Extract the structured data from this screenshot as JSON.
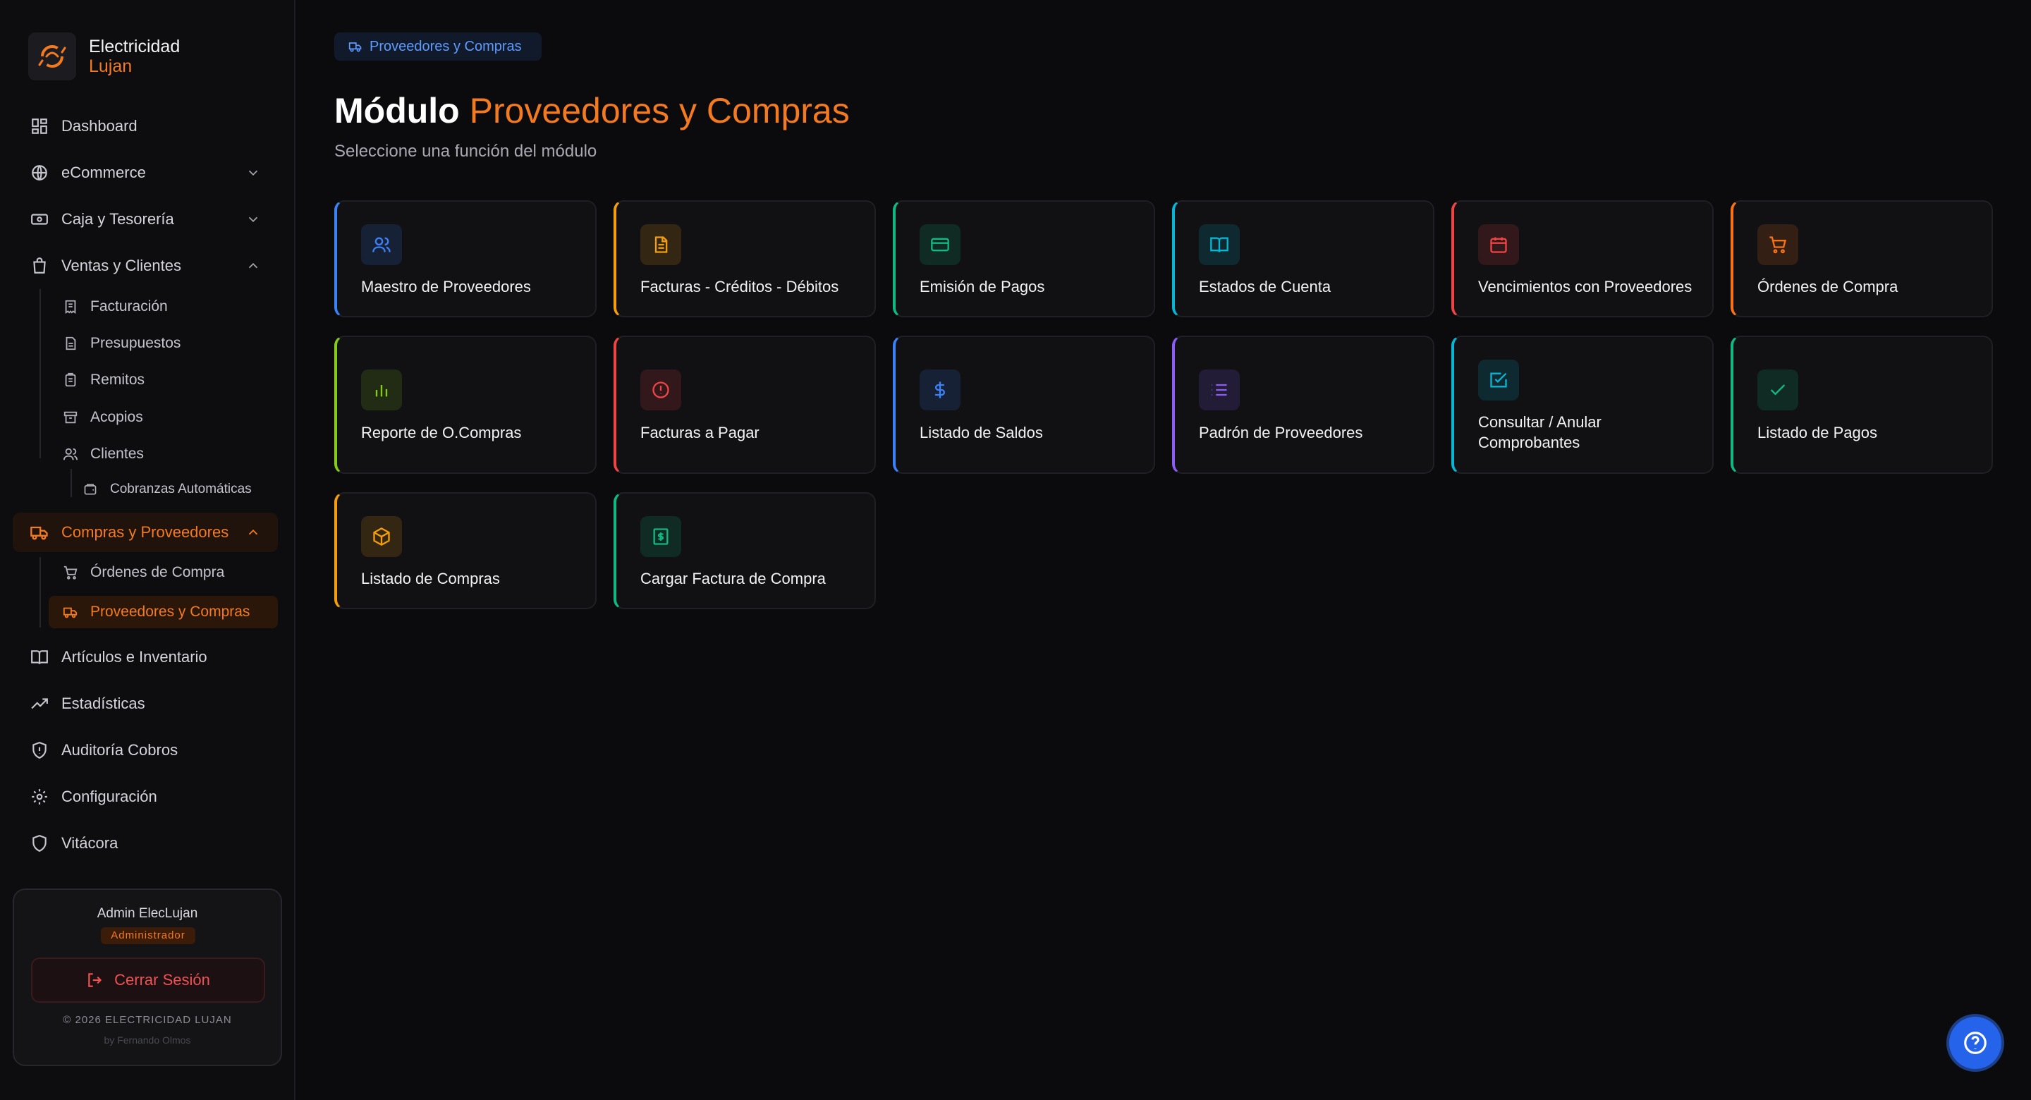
{
  "brand": {
    "name": "Electricidad",
    "sub": "Lujan"
  },
  "colors": {
    "accent": "#f47a20",
    "background": "#0b0b0d",
    "card": "#111114"
  },
  "nav": {
    "dashboard": "Dashboard",
    "ecommerce": "eCommerce",
    "caja": "Caja y Tesorería",
    "ventas": "Ventas y Clientes",
    "facturacion": "Facturación",
    "presupuestos": "Presupuestos",
    "remitos": "Remitos",
    "acopios": "Acopios",
    "clientes": "Clientes",
    "cobranzas": "Cobranzas Automáticas",
    "compras": "Compras y Proveedores",
    "ordenes": "Órdenes de Compra",
    "proveedores_compras": "Proveedores y Compras",
    "articulos": "Artículos e Inventario",
    "estadisticas": "Estadísticas",
    "auditoria": "Auditoría Cobros",
    "configuracion": "Configuración",
    "vitacora": "Vitácora"
  },
  "user": {
    "name": "Admin ElecLujan",
    "role": "Administrador",
    "logout": "Cerrar Sesión",
    "copyright": "© 2026 ELECTRICIDAD LUJAN",
    "byline": "by Fernando Olmos"
  },
  "breadcrumb": "Proveedores y Compras",
  "title": {
    "prefix": "Módulo",
    "accent": "Proveedores y Compras"
  },
  "subtitle": "Seleccione una función del módulo",
  "cards": [
    {
      "title": "Maestro de Proveedores",
      "icon": "users-icon",
      "color": "#3b82f6"
    },
    {
      "title": "Facturas - Créditos - Débitos",
      "icon": "file-text-icon",
      "color": "#f59e0b"
    },
    {
      "title": "Emisión de Pagos",
      "icon": "credit-card-icon",
      "color": "#10b981"
    },
    {
      "title": "Estados de Cuenta",
      "icon": "book-open-icon",
      "color": "#06b6d4"
    },
    {
      "title": "Vencimientos con Proveedores",
      "icon": "calendar-icon",
      "color": "#ef4444"
    },
    {
      "title": "Órdenes de Compra",
      "icon": "cart-icon",
      "color": "#f97316"
    },
    {
      "title": "Reporte de O.Compras",
      "icon": "bar-chart-icon",
      "color": "#84cc16"
    },
    {
      "title": "Facturas a Pagar",
      "icon": "alert-circle-icon",
      "color": "#ef4444"
    },
    {
      "title": "Listado de Saldos",
      "icon": "dollar-icon",
      "color": "#3b82f6"
    },
    {
      "title": "Padrón de Proveedores",
      "icon": "list-icon",
      "color": "#8b5cf6"
    },
    {
      "title": "Consultar / Anular Comprobantes",
      "icon": "check-square-icon",
      "color": "#06b6d4"
    },
    {
      "title": "Listado de Pagos",
      "icon": "check-icon",
      "color": "#10b981"
    },
    {
      "title": "Listado de Compras",
      "icon": "package-icon",
      "color": "#f59e0b"
    },
    {
      "title": "Cargar Factura de Compra",
      "icon": "receipt-icon",
      "color": "#10b981"
    }
  ]
}
